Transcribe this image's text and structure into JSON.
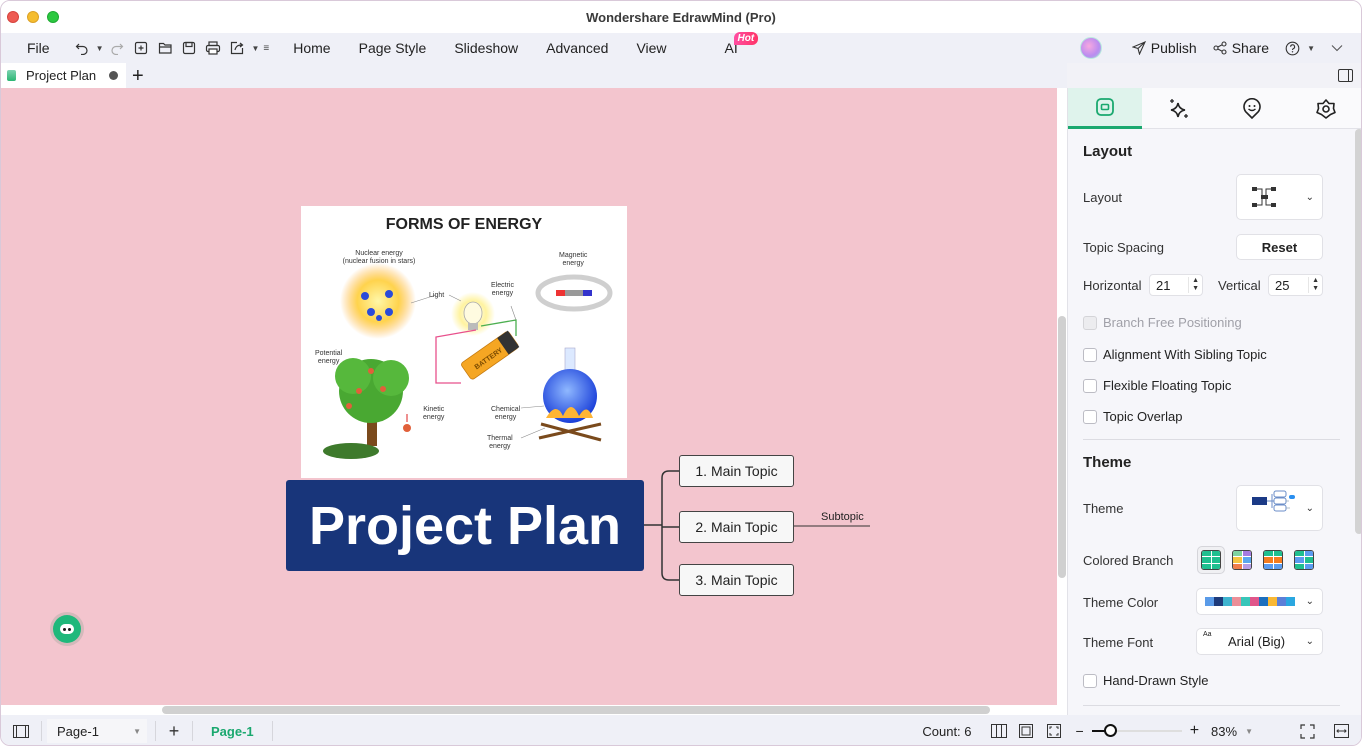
{
  "window": {
    "title": "Wondershare EdrawMind (Pro)"
  },
  "menubar": {
    "file": "File",
    "items": [
      "Home",
      "Page Style",
      "Slideshow",
      "Advanced",
      "View"
    ],
    "ai": "AI",
    "hot_badge": "Hot",
    "publish": "Publish",
    "share": "Share"
  },
  "tabs": {
    "document": "Project Plan"
  },
  "canvas": {
    "background_color": "#f3c5ce",
    "image": {
      "title": "FORMS OF ENERGY",
      "labels": {
        "nuclear": "Nuclear energy\n(nuclear fusion in stars)",
        "light": "Light",
        "electric": "Electric\nenergy",
        "magnetic": "Magnetic\nenergy",
        "potential": "Potential\nenergy",
        "kinetic": "Kinetic\nenergy",
        "chemical": "Chemical\nenergy",
        "thermal": "Thermal\nenergy",
        "battery": "BATTERY"
      }
    },
    "central_topic": "Project Plan",
    "central_color": "#18357a",
    "main_topics": [
      "1. Main Topic",
      "2. Main Topic",
      "3. Main Topic"
    ],
    "subtopic": "Subtopic"
  },
  "panel": {
    "tabs": [
      "layout-tab",
      "ai-tab",
      "icon-tab",
      "style-tab"
    ],
    "layout_section": {
      "title": "Layout",
      "layout_label": "Layout",
      "topic_spacing_label": "Topic Spacing",
      "reset_label": "Reset",
      "horizontal_label": "Horizontal",
      "horizontal_value": "21",
      "vertical_label": "Vertical",
      "vertical_value": "25",
      "checkboxes": [
        {
          "label": "Branch Free Positioning",
          "checked": false,
          "disabled": true
        },
        {
          "label": "Alignment With Sibling Topic",
          "checked": false,
          "disabled": false
        },
        {
          "label": "Flexible Floating Topic",
          "checked": false,
          "disabled": false
        },
        {
          "label": "Topic Overlap",
          "checked": false,
          "disabled": false
        }
      ]
    },
    "theme_section": {
      "title": "Theme",
      "theme_label": "Theme",
      "colored_branch_label": "Colored Branch",
      "theme_color_label": "Theme Color",
      "theme_color_swatches": [
        "#5a9be8",
        "#1e3a7a",
        "#3fb4cf",
        "#ec8f98",
        "#38c6b9",
        "#e0568a",
        "#1c6fbe",
        "#f9b833",
        "#5b7fd8",
        "#2aa7e0"
      ],
      "theme_font_label": "Theme Font",
      "theme_font_value": "Arial (Big)",
      "hand_drawn_label": "Hand-Drawn Style"
    }
  },
  "statusbar": {
    "page_select": "Page-1",
    "page_tab": "Page-1",
    "count": "Count: 6",
    "zoom_level": "83%",
    "zoom_fraction": 0.2
  }
}
